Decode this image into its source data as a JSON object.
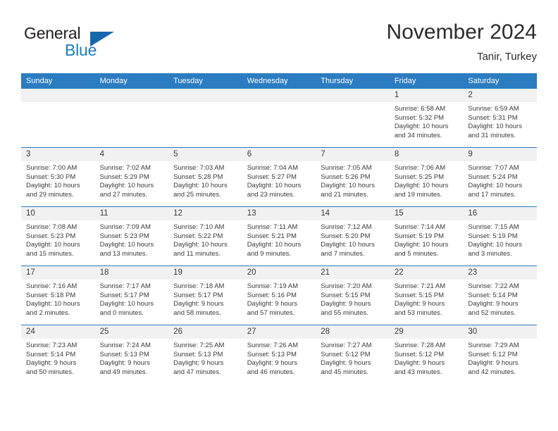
{
  "logo": {
    "primary_text": "General",
    "secondary_text": "Blue",
    "triangle_icon": "blue-triangle-icon",
    "primary_color": "#231f20",
    "secondary_color": "#1d7dc4"
  },
  "header": {
    "title": "November 2024",
    "subtitle": "Tanir, Turkey"
  },
  "theme": {
    "header_bg": "#2b7cc0",
    "header_text": "#ffffff",
    "daynum_bg": "#f1f1f1",
    "body_text": "#3a3a3a",
    "grid_line": "#2b7cc0"
  },
  "weekday_headers": [
    "Sunday",
    "Monday",
    "Tuesday",
    "Wednesday",
    "Thursday",
    "Friday",
    "Saturday"
  ],
  "weeks": [
    [
      {
        "day": "",
        "empty": true,
        "sunrise": "",
        "sunset": "",
        "daylight_1": "",
        "daylight_2": ""
      },
      {
        "day": "",
        "empty": true,
        "sunrise": "",
        "sunset": "",
        "daylight_1": "",
        "daylight_2": ""
      },
      {
        "day": "",
        "empty": true,
        "sunrise": "",
        "sunset": "",
        "daylight_1": "",
        "daylight_2": ""
      },
      {
        "day": "",
        "empty": true,
        "sunrise": "",
        "sunset": "",
        "daylight_1": "",
        "daylight_2": ""
      },
      {
        "day": "",
        "empty": true,
        "sunrise": "",
        "sunset": "",
        "daylight_1": "",
        "daylight_2": ""
      },
      {
        "day": "1",
        "empty": false,
        "sunrise": "Sunrise: 6:58 AM",
        "sunset": "Sunset: 5:32 PM",
        "daylight_1": "Daylight: 10 hours",
        "daylight_2": "and 34 minutes."
      },
      {
        "day": "2",
        "empty": false,
        "sunrise": "Sunrise: 6:59 AM",
        "sunset": "Sunset: 5:31 PM",
        "daylight_1": "Daylight: 10 hours",
        "daylight_2": "and 31 minutes."
      }
    ],
    [
      {
        "day": "3",
        "empty": false,
        "sunrise": "Sunrise: 7:00 AM",
        "sunset": "Sunset: 5:30 PM",
        "daylight_1": "Daylight: 10 hours",
        "daylight_2": "and 29 minutes."
      },
      {
        "day": "4",
        "empty": false,
        "sunrise": "Sunrise: 7:02 AM",
        "sunset": "Sunset: 5:29 PM",
        "daylight_1": "Daylight: 10 hours",
        "daylight_2": "and 27 minutes."
      },
      {
        "day": "5",
        "empty": false,
        "sunrise": "Sunrise: 7:03 AM",
        "sunset": "Sunset: 5:28 PM",
        "daylight_1": "Daylight: 10 hours",
        "daylight_2": "and 25 minutes."
      },
      {
        "day": "6",
        "empty": false,
        "sunrise": "Sunrise: 7:04 AM",
        "sunset": "Sunset: 5:27 PM",
        "daylight_1": "Daylight: 10 hours",
        "daylight_2": "and 23 minutes."
      },
      {
        "day": "7",
        "empty": false,
        "sunrise": "Sunrise: 7:05 AM",
        "sunset": "Sunset: 5:26 PM",
        "daylight_1": "Daylight: 10 hours",
        "daylight_2": "and 21 minutes."
      },
      {
        "day": "8",
        "empty": false,
        "sunrise": "Sunrise: 7:06 AM",
        "sunset": "Sunset: 5:25 PM",
        "daylight_1": "Daylight: 10 hours",
        "daylight_2": "and 19 minutes."
      },
      {
        "day": "9",
        "empty": false,
        "sunrise": "Sunrise: 7:07 AM",
        "sunset": "Sunset: 5:24 PM",
        "daylight_1": "Daylight: 10 hours",
        "daylight_2": "and 17 minutes."
      }
    ],
    [
      {
        "day": "10",
        "empty": false,
        "sunrise": "Sunrise: 7:08 AM",
        "sunset": "Sunset: 5:23 PM",
        "daylight_1": "Daylight: 10 hours",
        "daylight_2": "and 15 minutes."
      },
      {
        "day": "11",
        "empty": false,
        "sunrise": "Sunrise: 7:09 AM",
        "sunset": "Sunset: 5:23 PM",
        "daylight_1": "Daylight: 10 hours",
        "daylight_2": "and 13 minutes."
      },
      {
        "day": "12",
        "empty": false,
        "sunrise": "Sunrise: 7:10 AM",
        "sunset": "Sunset: 5:22 PM",
        "daylight_1": "Daylight: 10 hours",
        "daylight_2": "and 11 minutes."
      },
      {
        "day": "13",
        "empty": false,
        "sunrise": "Sunrise: 7:11 AM",
        "sunset": "Sunset: 5:21 PM",
        "daylight_1": "Daylight: 10 hours",
        "daylight_2": "and 9 minutes."
      },
      {
        "day": "14",
        "empty": false,
        "sunrise": "Sunrise: 7:12 AM",
        "sunset": "Sunset: 5:20 PM",
        "daylight_1": "Daylight: 10 hours",
        "daylight_2": "and 7 minutes."
      },
      {
        "day": "15",
        "empty": false,
        "sunrise": "Sunrise: 7:14 AM",
        "sunset": "Sunset: 5:19 PM",
        "daylight_1": "Daylight: 10 hours",
        "daylight_2": "and 5 minutes."
      },
      {
        "day": "16",
        "empty": false,
        "sunrise": "Sunrise: 7:15 AM",
        "sunset": "Sunset: 5:19 PM",
        "daylight_1": "Daylight: 10 hours",
        "daylight_2": "and 3 minutes."
      }
    ],
    [
      {
        "day": "17",
        "empty": false,
        "sunrise": "Sunrise: 7:16 AM",
        "sunset": "Sunset: 5:18 PM",
        "daylight_1": "Daylight: 10 hours",
        "daylight_2": "and 2 minutes."
      },
      {
        "day": "18",
        "empty": false,
        "sunrise": "Sunrise: 7:17 AM",
        "sunset": "Sunset: 5:17 PM",
        "daylight_1": "Daylight: 10 hours",
        "daylight_2": "and 0 minutes."
      },
      {
        "day": "19",
        "empty": false,
        "sunrise": "Sunrise: 7:18 AM",
        "sunset": "Sunset: 5:17 PM",
        "daylight_1": "Daylight: 9 hours",
        "daylight_2": "and 58 minutes."
      },
      {
        "day": "20",
        "empty": false,
        "sunrise": "Sunrise: 7:19 AM",
        "sunset": "Sunset: 5:16 PM",
        "daylight_1": "Daylight: 9 hours",
        "daylight_2": "and 57 minutes."
      },
      {
        "day": "21",
        "empty": false,
        "sunrise": "Sunrise: 7:20 AM",
        "sunset": "Sunset: 5:15 PM",
        "daylight_1": "Daylight: 9 hours",
        "daylight_2": "and 55 minutes."
      },
      {
        "day": "22",
        "empty": false,
        "sunrise": "Sunrise: 7:21 AM",
        "sunset": "Sunset: 5:15 PM",
        "daylight_1": "Daylight: 9 hours",
        "daylight_2": "and 53 minutes."
      },
      {
        "day": "23",
        "empty": false,
        "sunrise": "Sunrise: 7:22 AM",
        "sunset": "Sunset: 5:14 PM",
        "daylight_1": "Daylight: 9 hours",
        "daylight_2": "and 52 minutes."
      }
    ],
    [
      {
        "day": "24",
        "empty": false,
        "sunrise": "Sunrise: 7:23 AM",
        "sunset": "Sunset: 5:14 PM",
        "daylight_1": "Daylight: 9 hours",
        "daylight_2": "and 50 minutes."
      },
      {
        "day": "25",
        "empty": false,
        "sunrise": "Sunrise: 7:24 AM",
        "sunset": "Sunset: 5:13 PM",
        "daylight_1": "Daylight: 9 hours",
        "daylight_2": "and 49 minutes."
      },
      {
        "day": "26",
        "empty": false,
        "sunrise": "Sunrise: 7:25 AM",
        "sunset": "Sunset: 5:13 PM",
        "daylight_1": "Daylight: 9 hours",
        "daylight_2": "and 47 minutes."
      },
      {
        "day": "27",
        "empty": false,
        "sunrise": "Sunrise: 7:26 AM",
        "sunset": "Sunset: 5:13 PM",
        "daylight_1": "Daylight: 9 hours",
        "daylight_2": "and 46 minutes."
      },
      {
        "day": "28",
        "empty": false,
        "sunrise": "Sunrise: 7:27 AM",
        "sunset": "Sunset: 5:12 PM",
        "daylight_1": "Daylight: 9 hours",
        "daylight_2": "and 45 minutes."
      },
      {
        "day": "29",
        "empty": false,
        "sunrise": "Sunrise: 7:28 AM",
        "sunset": "Sunset: 5:12 PM",
        "daylight_1": "Daylight: 9 hours",
        "daylight_2": "and 43 minutes."
      },
      {
        "day": "30",
        "empty": false,
        "sunrise": "Sunrise: 7:29 AM",
        "sunset": "Sunset: 5:12 PM",
        "daylight_1": "Daylight: 9 hours",
        "daylight_2": "and 42 minutes."
      }
    ]
  ]
}
